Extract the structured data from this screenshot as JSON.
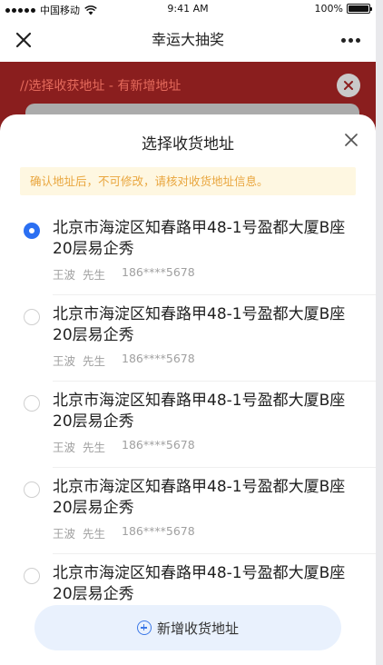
{
  "status_bar": {
    "carrier": "中国移动",
    "time": "9:41 AM",
    "battery": "100%",
    "battery_level": 1.0
  },
  "nav": {
    "title": "幸运大抽奖"
  },
  "background": {
    "hint": "//选择收获地址 - 有新增地址"
  },
  "sheet": {
    "title": "选择收货地址",
    "notice": "确认地址后，不可修改，请核对收货地址信息。",
    "addresses": [
      {
        "address": "北京市海淀区知春路甲48-1号盈都大厦B座20层易企秀",
        "name": "王波",
        "title": "先生",
        "phone": "186****5678",
        "selected": true
      },
      {
        "address": "北京市海淀区知春路甲48-1号盈都大厦B座20层易企秀",
        "name": "王波",
        "title": "先生",
        "phone": "186****5678",
        "selected": false
      },
      {
        "address": "北京市海淀区知春路甲48-1号盈都大厦B座20层易企秀",
        "name": "王波",
        "title": "先生",
        "phone": "186****5678",
        "selected": false
      },
      {
        "address": "北京市海淀区知春路甲48-1号盈都大厦B座20层易企秀",
        "name": "王波",
        "title": "先生",
        "phone": "186****5678",
        "selected": false
      },
      {
        "address": "北京市海淀区知春路甲48-1号盈都大厦B座20层易企秀",
        "name": "",
        "title": "",
        "phone": "",
        "selected": false
      }
    ],
    "add_button_label": "新增收货地址"
  },
  "icons": {
    "nav_close": "close-icon",
    "nav_more": "more-icon",
    "sheet_close": "close-icon",
    "add": "plus-circle-icon",
    "wifi": "wifi-icon",
    "battery": "battery-icon"
  },
  "colors": {
    "accent": "#2b6ff2",
    "background_red": "#8a1e1e",
    "notice_bg": "#fef7e1",
    "notice_text": "#e9a63e",
    "add_button_bg": "#e9f1fd"
  }
}
